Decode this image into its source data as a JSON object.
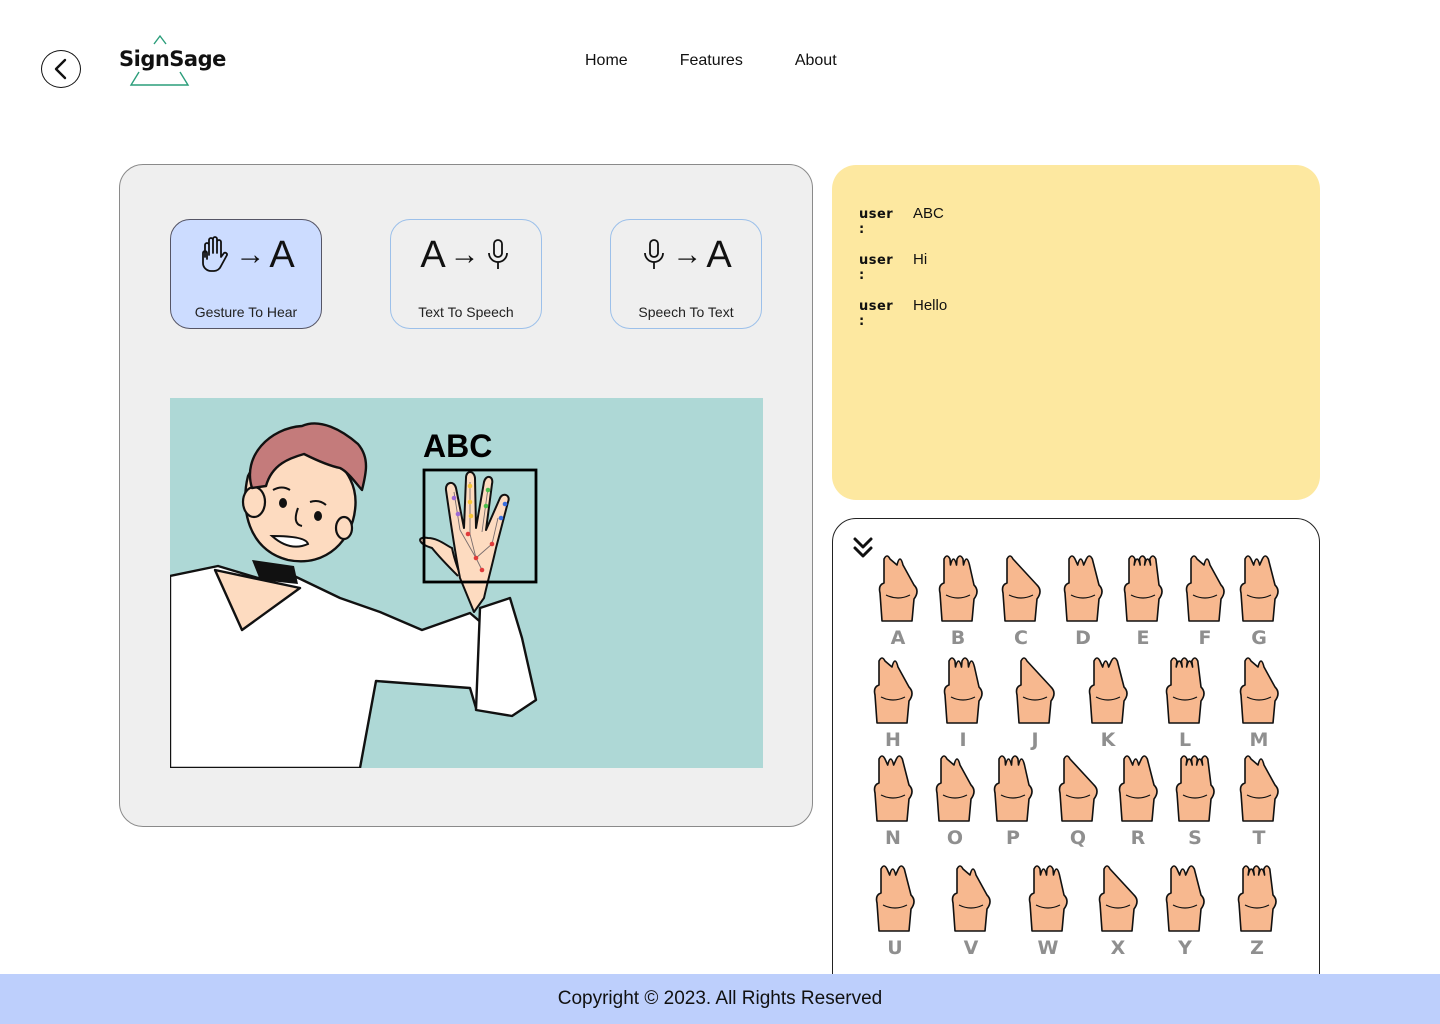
{
  "header": {
    "back_icon": "chevron-left-icon",
    "logo_text": "SignSage",
    "nav": [
      {
        "label": "Home"
      },
      {
        "label": "Features"
      },
      {
        "label": "About"
      }
    ]
  },
  "modes": [
    {
      "label": "Gesture To Hear",
      "from": "",
      "to": "A",
      "from_icon": "hand-icon",
      "to_icon": "",
      "active": true
    },
    {
      "label": "Text To Speech",
      "from": "A",
      "to": "",
      "from_icon": "",
      "to_icon": "microphone-icon",
      "active": false
    },
    {
      "label": "Speech To Text",
      "from": "",
      "to": "A",
      "from_icon": "microphone-icon",
      "to_icon": "",
      "active": false
    }
  ],
  "camera": {
    "detected_text": "ABC"
  },
  "chat": {
    "messages": [
      {
        "who": "user :",
        "text": "ABC"
      },
      {
        "who": "user :",
        "text": "Hi"
      },
      {
        "who": "user :",
        "text": "Hello"
      }
    ]
  },
  "alphabet": {
    "collapse_icon": "double-chevron-down-icon",
    "letters": [
      "A",
      "B",
      "C",
      "D",
      "E",
      "F",
      "G",
      "H",
      "I",
      "J",
      "K",
      "L",
      "M",
      "N",
      "O",
      "P",
      "Q",
      "R",
      "S",
      "T",
      "U",
      "V",
      "W",
      "X",
      "Y",
      "Z"
    ]
  },
  "footer": {
    "copyright": "Copyright © 2023. All Rights Reserved"
  },
  "colors": {
    "active_card": "#ccdcff",
    "chat_bg": "#fde8a0",
    "camera_bg": "#aed8d6",
    "footer_bg": "#bdcffc",
    "skin": "#f7b88f"
  }
}
